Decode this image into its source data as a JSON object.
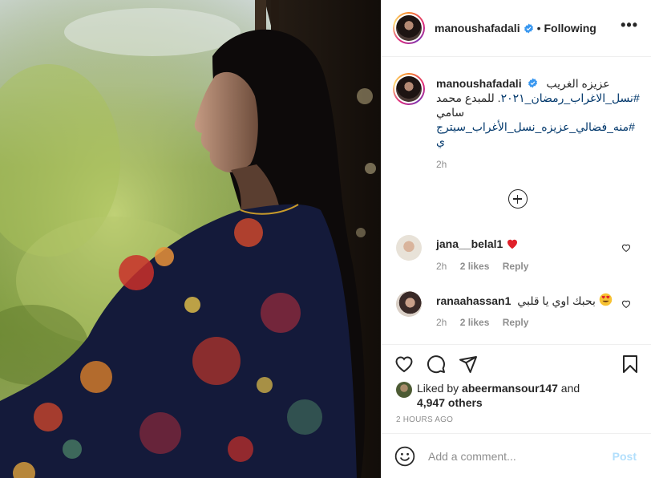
{
  "post": {
    "username": "manoushafadali",
    "follow_status": "Following",
    "separator": "•",
    "more_icon": "more-horizontal-icon"
  },
  "caption": {
    "username": "manoushafadali",
    "line1": "عزيزه الغريب",
    "line2_tag": "#نسل_الاغراب_رمضان_٢٠٢١",
    "line2_rest": ". للمبدع محمد",
    "line3": "سامي",
    "line4_tag": "#منه_فضالي_عزيزه_نسل_الأغراب_سيترج",
    "line5_tag": "ي",
    "time": "2h"
  },
  "comments": [
    {
      "username": "jana__belal1",
      "text": "",
      "emoji": "red-heart",
      "time": "2h",
      "likes": "2 likes",
      "reply": "Reply"
    },
    {
      "username": "ranaahassan1",
      "text": "بحبك اوي يا قلبي",
      "emoji": "heart-eyes",
      "time": "2h",
      "likes": "2 likes",
      "reply": "Reply"
    }
  ],
  "likes": {
    "prefix": "Liked by",
    "liker": "abeermansour147",
    "conj": "and",
    "others": "4,947 others"
  },
  "timestamp": "2 HOURS AGO",
  "add_comment": {
    "placeholder": "Add a comment...",
    "post_label": "Post"
  },
  "colors": {
    "link": "#00376b",
    "muted": "#8e8e8e",
    "verified": "#3897f0",
    "post_disabled": "#b2dffc",
    "like_red": "#ed4956"
  }
}
